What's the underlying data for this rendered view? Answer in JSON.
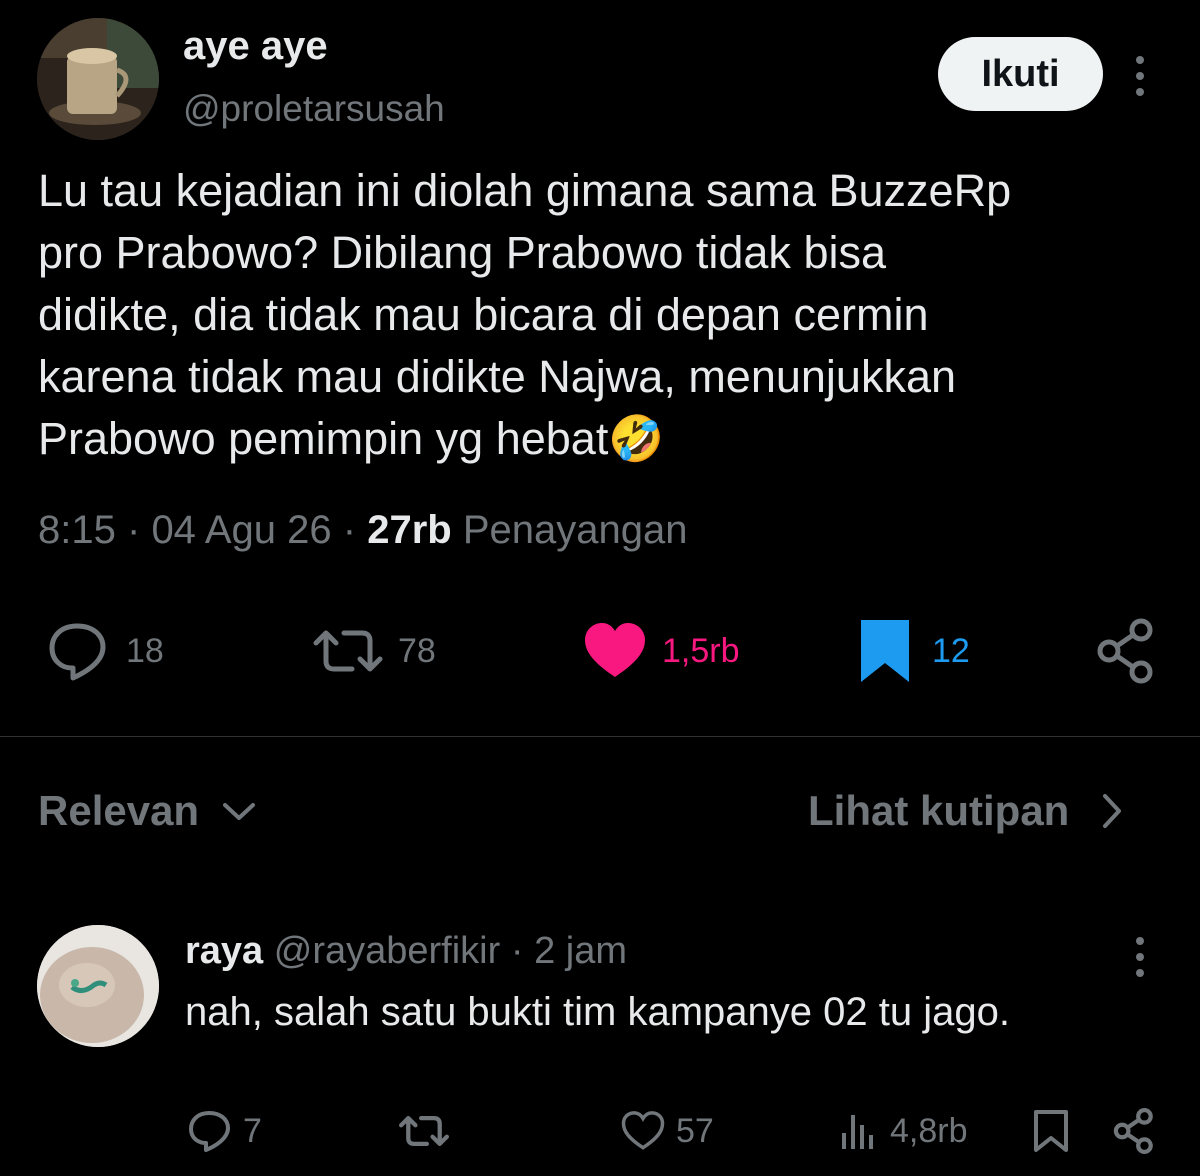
{
  "author": {
    "display_name": "aye aye",
    "handle": "@proletarsusah",
    "follow_label": "Ikuti"
  },
  "tweet": {
    "text": "Lu tau kejadian ini diolah gimana sama BuzzeRp\npro Prabowo? Dibilang Prabowo tidak bisa\ndidikte, dia tidak mau bicara di depan cermin\nkarena tidak mau didikte Najwa, menunjukkan\nPrabowo pemimpin yg hebat",
    "emoji": "🤣",
    "time": "8:15",
    "date": "04 Agu 26",
    "separator": "·",
    "views_count": "27rb",
    "views_label": "Penayangan"
  },
  "actions": {
    "replies": "18",
    "retweets": "78",
    "likes": "1,5rb",
    "bookmarks": "12"
  },
  "colors": {
    "like": "#f91880",
    "bookmark": "#1d9bf0",
    "muted": "#71767b",
    "text": "#e7e9ea"
  },
  "filters": {
    "sort_label": "Relevan",
    "quotes_label": "Lihat kutipan"
  },
  "reply": {
    "name": "raya",
    "handle": "@rayaberfikir",
    "separator": "·",
    "time": "2 jam",
    "text": "nah, salah satu bukti tim kampanye 02 tu jago.",
    "replies": "7",
    "likes": "57",
    "views": "4,8rb"
  },
  "icons": {
    "reply": "speech-bubble-icon",
    "retweet": "retweet-arrows-icon",
    "like": "heart-icon",
    "bookmark": "bookmark-icon",
    "share": "share-nodes-icon",
    "views": "bar-chart-icon",
    "more": "vertical-dots-icon",
    "sort": "chevron-down-icon",
    "quotes": "chevron-right-icon"
  }
}
